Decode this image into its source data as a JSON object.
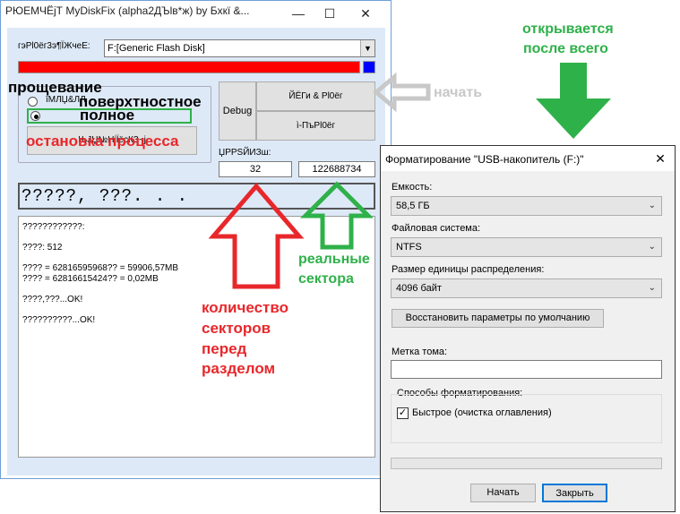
{
  "main_window": {
    "title": "РЮЕМЧЁјТ MyDiskFix (alpha2ДЪlв*ж) by Бхкї &...",
    "minimize": "—",
    "maximize": "☐",
    "close": "✕",
    "drive_label": "гэРl0ёг3э¶ЇЖчеЕ:",
    "drive_value": "F:[Generic Flash Disk]",
    "radio_low": "ïМЛЏ&ЛЛ",
    "radio_high": "ѕНЇЇёсКЗ...",
    "debug_button": "Debug",
    "start_button": "ЙЁГи & Рl0ёг",
    "format_button": "ì-ПъРl0ёг",
    "stop_button": "ЊЈЏ№НіЇёсКЗ¬ј",
    "sectors_label": "ЏРРЅЙИЗш:",
    "sectors_before": "32",
    "sectors_real": "122688734",
    "status_text": "?????, ???. . .",
    "log_lines": [
      "????????????:",
      "",
      "????: 512",
      "",
      "???? = 62816595968?? = 59906,57MB",
      "???? = 62816615424?? = 0,02MB",
      "",
      "????,???...OK!",
      "",
      "??????????...OK!"
    ]
  },
  "annotations": {
    "farewell": "прощевание",
    "surface": "поверхтностное",
    "full": "полное",
    "stop_process": "остановка процесса",
    "start": "начать",
    "opens_after_line1": "открывается",
    "opens_after_line2": "после всего",
    "real_sectors_line1": "реальные",
    "real_sectors_line2": "сектора",
    "count_line1": "количество",
    "count_line2": "секторов",
    "count_line3": "перед",
    "count_line4": "разделом"
  },
  "format_dialog": {
    "title": "Форматирование \"USB-накопитель (F:)\"",
    "close": "✕",
    "capacity_label": "Емкость:",
    "capacity_value": "58,5 ГБ",
    "fs_label": "Файловая система:",
    "fs_value": "NTFS",
    "alloc_label": "Размер единицы распределения:",
    "alloc_value": "4096 байт",
    "restore_defaults": "Восстановить параметры по умолчанию",
    "volume_label": "Метка тома:",
    "volume_value": "",
    "format_options_label": "Способы форматирования:",
    "quick_format": "Быстрое (очистка оглавления)",
    "quick_format_checked": true,
    "start_button": "Начать",
    "close_button": "Закрыть"
  },
  "colors": {
    "progress_red": "#ff0000",
    "progress_blue": "#0000ff",
    "annotation_red": "#e8272b",
    "annotation_green": "#2fb14a",
    "annotation_gray": "#c8c8c8"
  }
}
